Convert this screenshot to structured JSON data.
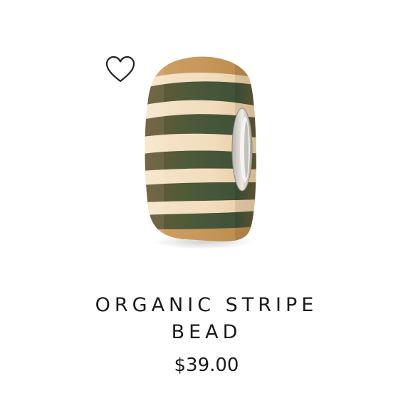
{
  "product": {
    "name_line_1": "ORGANIC STRIPE",
    "name_line_2": "BEAD",
    "price": "$39.00",
    "image_icon": "striped-glass-bead-image",
    "wishlist_icon": "heart-outline-icon"
  },
  "colors": {
    "background": "#ffffff",
    "text": "#1a1a1a",
    "bead_amber": "#c89a5a",
    "bead_cream": "#f3dfc3",
    "bead_stripe": "#5a5634",
    "core_silver": "#d9d6d2"
  }
}
